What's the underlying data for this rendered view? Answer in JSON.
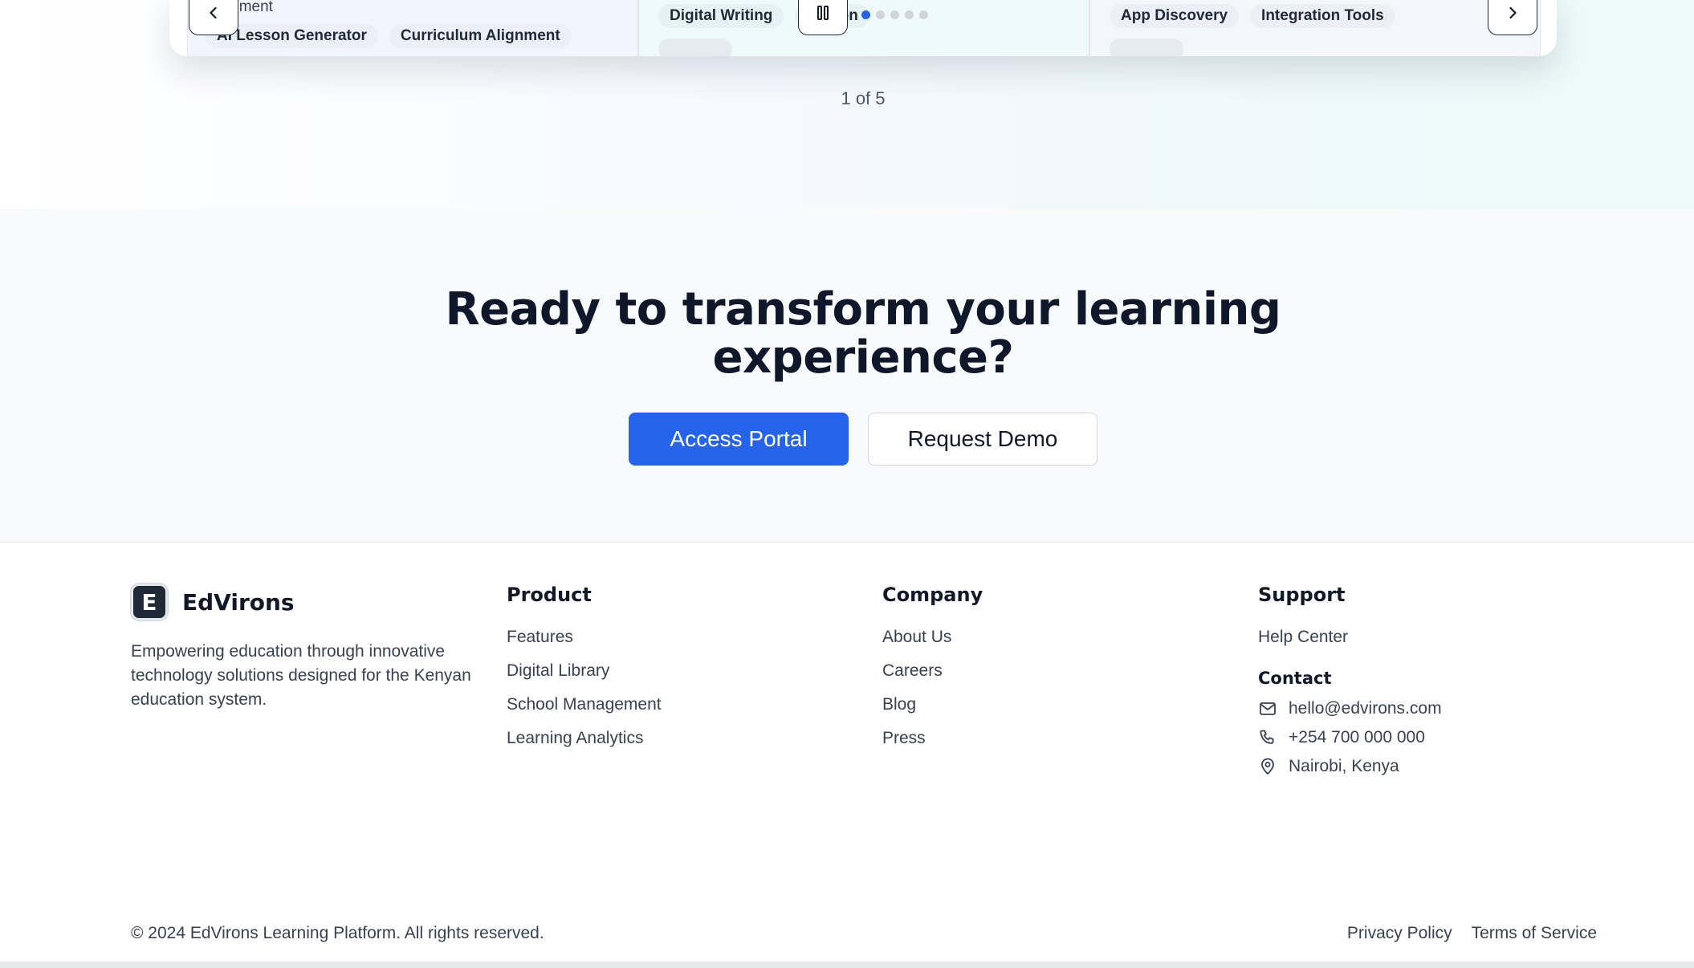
{
  "carousel": {
    "slides": [
      {
        "title_fragment": "agement",
        "tags": [
          "AI Lesson Generator",
          "Curriculum Alignment"
        ]
      },
      {
        "tags": [
          "Digital Writing",
          "oration"
        ]
      },
      {
        "tags": [
          "App Discovery",
          "Integration Tools"
        ]
      }
    ],
    "prev_icon": "chevron-left-icon",
    "next_icon": "chevron-right-icon",
    "pause_icon": "pause-icon",
    "dots_total": 5,
    "dots_active_index": 0,
    "page_indicator": "1 of 5",
    "active_dot_color": "#2563eb"
  },
  "cta": {
    "title_line1": "Ready to transform your learning",
    "title_line2": "experience?",
    "primary_label": "Access Portal",
    "secondary_label": "Request Demo",
    "primary_color": "#2563eb"
  },
  "footer": {
    "brand": {
      "logo_letter": "E",
      "name": "EdVirons",
      "description": "Empowering education through innovative technology solutions designed for the Kenyan education system."
    },
    "product": {
      "heading": "Product",
      "links": [
        "Features",
        "Digital Library",
        "School Management",
        "Learning Analytics"
      ]
    },
    "company": {
      "heading": "Company",
      "links": [
        "About Us",
        "Careers",
        "Blog",
        "Press"
      ]
    },
    "support": {
      "heading": "Support",
      "links": [
        "Help Center"
      ],
      "contact_heading": "Contact",
      "email": "hello@edvirons.com",
      "phone": "+254 700 000 000",
      "location": "Nairobi, Kenya"
    },
    "copyright": "© 2024 EdVirons Learning Platform. All rights reserved.",
    "legal": {
      "privacy": "Privacy Policy",
      "terms": "Terms of Service"
    }
  }
}
